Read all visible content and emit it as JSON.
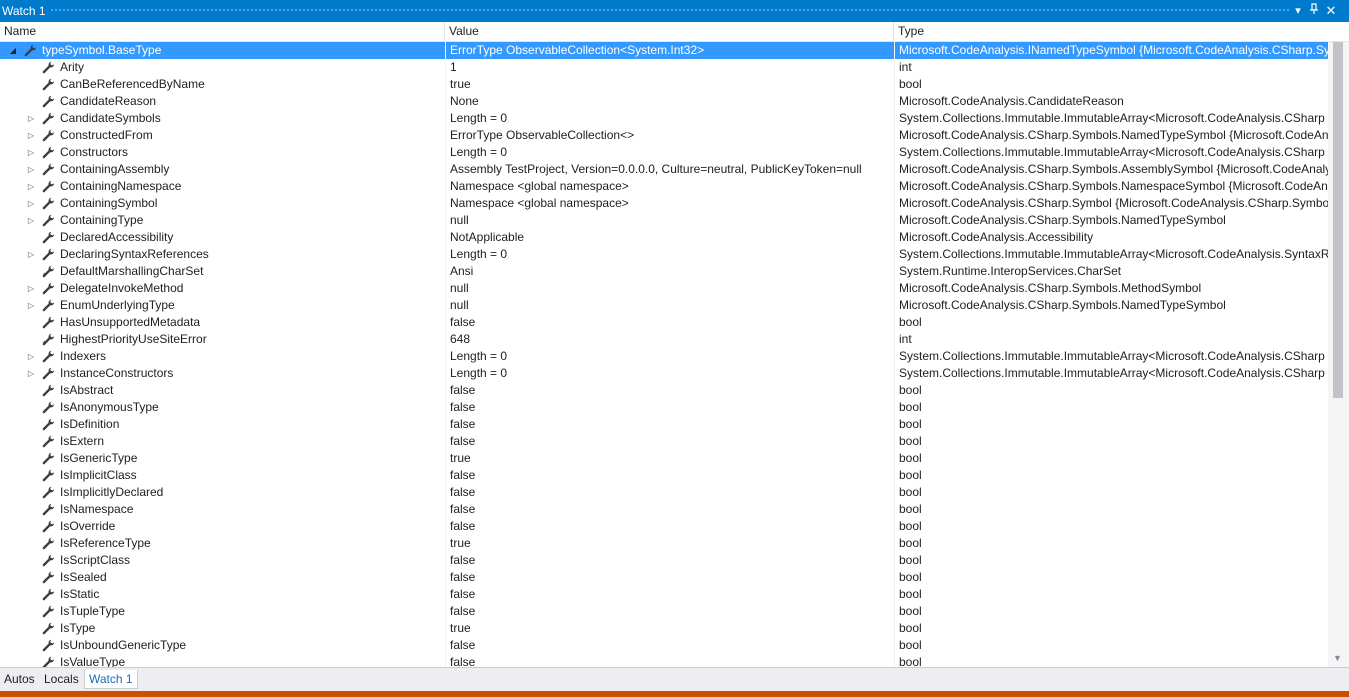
{
  "window": {
    "title": "Watch 1"
  },
  "columns": {
    "name": "Name",
    "value": "Value",
    "type": "Type"
  },
  "rows": [
    {
      "name": "typeSymbol.BaseType",
      "value": "ErrorType ObservableCollection<System.Int32>",
      "type": "Microsoft.CodeAnalysis.INamedTypeSymbol {Microsoft.CodeAnalysis.CSharp.Sy",
      "expand": "expanded",
      "level": 0,
      "selected": true
    },
    {
      "name": "Arity",
      "value": "1",
      "type": "int",
      "expand": "none",
      "level": 1
    },
    {
      "name": "CanBeReferencedByName",
      "value": "true",
      "type": "bool",
      "expand": "none",
      "level": 1
    },
    {
      "name": "CandidateReason",
      "value": "None",
      "type": "Microsoft.CodeAnalysis.CandidateReason",
      "expand": "none",
      "level": 1
    },
    {
      "name": "CandidateSymbols",
      "value": "Length = 0",
      "type": "System.Collections.Immutable.ImmutableArray<Microsoft.CodeAnalysis.CSharp",
      "expand": "collapsed",
      "level": 1
    },
    {
      "name": "ConstructedFrom",
      "value": "ErrorType ObservableCollection<>",
      "type": "Microsoft.CodeAnalysis.CSharp.Symbols.NamedTypeSymbol {Microsoft.CodeAn",
      "expand": "collapsed",
      "level": 1
    },
    {
      "name": "Constructors",
      "value": "Length = 0",
      "type": "System.Collections.Immutable.ImmutableArray<Microsoft.CodeAnalysis.CSharp",
      "expand": "collapsed",
      "level": 1
    },
    {
      "name": "ContainingAssembly",
      "value": "Assembly TestProject, Version=0.0.0.0, Culture=neutral, PublicKeyToken=null",
      "type": "Microsoft.CodeAnalysis.CSharp.Symbols.AssemblySymbol {Microsoft.CodeAnaly",
      "expand": "collapsed",
      "level": 1
    },
    {
      "name": "ContainingNamespace",
      "value": "Namespace <global namespace>",
      "type": "Microsoft.CodeAnalysis.CSharp.Symbols.NamespaceSymbol {Microsoft.CodeAn",
      "expand": "collapsed",
      "level": 1
    },
    {
      "name": "ContainingSymbol",
      "value": "Namespace <global namespace>",
      "type": "Microsoft.CodeAnalysis.CSharp.Symbol {Microsoft.CodeAnalysis.CSharp.Symbol",
      "expand": "collapsed",
      "level": 1
    },
    {
      "name": "ContainingType",
      "value": "null",
      "type": "Microsoft.CodeAnalysis.CSharp.Symbols.NamedTypeSymbol",
      "expand": "collapsed",
      "level": 1
    },
    {
      "name": "DeclaredAccessibility",
      "value": "NotApplicable",
      "type": "Microsoft.CodeAnalysis.Accessibility",
      "expand": "none",
      "level": 1
    },
    {
      "name": "DeclaringSyntaxReferences",
      "value": "Length = 0",
      "type": "System.Collections.Immutable.ImmutableArray<Microsoft.CodeAnalysis.SyntaxR",
      "expand": "collapsed",
      "level": 1
    },
    {
      "name": "DefaultMarshallingCharSet",
      "value": "Ansi",
      "type": "System.Runtime.InteropServices.CharSet",
      "expand": "none",
      "level": 1,
      "icon": "wrench-star-icon"
    },
    {
      "name": "DelegateInvokeMethod",
      "value": "null",
      "type": "Microsoft.CodeAnalysis.CSharp.Symbols.MethodSymbol",
      "expand": "collapsed",
      "level": 1
    },
    {
      "name": "EnumUnderlyingType",
      "value": "null",
      "type": "Microsoft.CodeAnalysis.CSharp.Symbols.NamedTypeSymbol",
      "expand": "collapsed",
      "level": 1
    },
    {
      "name": "HasUnsupportedMetadata",
      "value": "false",
      "type": "bool",
      "expand": "none",
      "level": 1
    },
    {
      "name": "HighestPriorityUseSiteError",
      "value": "648",
      "type": "int",
      "expand": "none",
      "level": 1,
      "icon": "wrench-star-icon"
    },
    {
      "name": "Indexers",
      "value": "Length = 0",
      "type": "System.Collections.Immutable.ImmutableArray<Microsoft.CodeAnalysis.CSharp",
      "expand": "collapsed",
      "level": 1
    },
    {
      "name": "InstanceConstructors",
      "value": "Length = 0",
      "type": "System.Collections.Immutable.ImmutableArray<Microsoft.CodeAnalysis.CSharp",
      "expand": "collapsed",
      "level": 1
    },
    {
      "name": "IsAbstract",
      "value": "false",
      "type": "bool",
      "expand": "none",
      "level": 1
    },
    {
      "name": "IsAnonymousType",
      "value": "false",
      "type": "bool",
      "expand": "none",
      "level": 1
    },
    {
      "name": "IsDefinition",
      "value": "false",
      "type": "bool",
      "expand": "none",
      "level": 1
    },
    {
      "name": "IsExtern",
      "value": "false",
      "type": "bool",
      "expand": "none",
      "level": 1
    },
    {
      "name": "IsGenericType",
      "value": "true",
      "type": "bool",
      "expand": "none",
      "level": 1
    },
    {
      "name": "IsImplicitClass",
      "value": "false",
      "type": "bool",
      "expand": "none",
      "level": 1
    },
    {
      "name": "IsImplicitlyDeclared",
      "value": "false",
      "type": "bool",
      "expand": "none",
      "level": 1
    },
    {
      "name": "IsNamespace",
      "value": "false",
      "type": "bool",
      "expand": "none",
      "level": 1
    },
    {
      "name": "IsOverride",
      "value": "false",
      "type": "bool",
      "expand": "none",
      "level": 1
    },
    {
      "name": "IsReferenceType",
      "value": "true",
      "type": "bool",
      "expand": "none",
      "level": 1
    },
    {
      "name": "IsScriptClass",
      "value": "false",
      "type": "bool",
      "expand": "none",
      "level": 1
    },
    {
      "name": "IsSealed",
      "value": "false",
      "type": "bool",
      "expand": "none",
      "level": 1
    },
    {
      "name": "IsStatic",
      "value": "false",
      "type": "bool",
      "expand": "none",
      "level": 1
    },
    {
      "name": "IsTupleType",
      "value": "false",
      "type": "bool",
      "expand": "none",
      "level": 1
    },
    {
      "name": "IsType",
      "value": "true",
      "type": "bool",
      "expand": "none",
      "level": 1
    },
    {
      "name": "IsUnboundGenericType",
      "value": "false",
      "type": "bool",
      "expand": "none",
      "level": 1
    },
    {
      "name": "IsValueType",
      "value": "false",
      "type": "bool",
      "expand": "none",
      "level": 1
    }
  ],
  "tabs": [
    {
      "label": "Autos",
      "active": false
    },
    {
      "label": "Locals",
      "active": false
    },
    {
      "label": "Watch 1",
      "active": true
    }
  ],
  "colors": {
    "accent": "#007acc",
    "selection": "#3399ff",
    "status_bar": "#ca5100"
  }
}
